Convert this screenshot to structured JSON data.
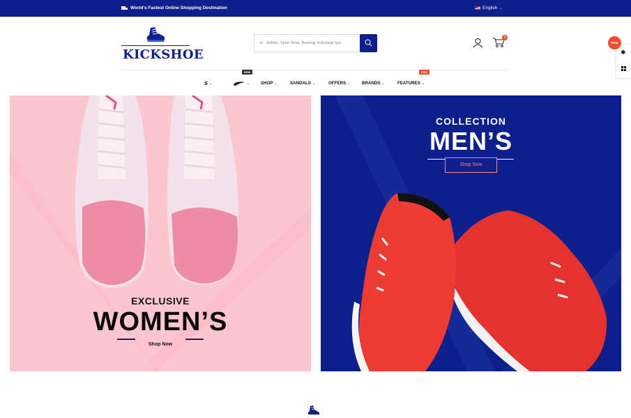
{
  "topbar": {
    "promo_text": "World's Fastest Online Shopping Destination",
    "language": "English",
    "icons": [
      "truck-icon",
      "flag-icon",
      "chevron-down-icon"
    ]
  },
  "header": {
    "logo_text": "KICKSHOE",
    "search_placeholder": "ex : Adidas, Sport Shoe, Bowling, Individual Spo",
    "cart_count": "0",
    "icons": [
      "search-icon",
      "user-icon",
      "cart-icon"
    ]
  },
  "sidebar_tools": {
    "new_badge": "NEW",
    "icons": [
      "gear-icon",
      "grid-icon"
    ]
  },
  "nav": {
    "items": [
      {
        "label": "S",
        "type": "brand-logo"
      },
      {
        "label": "",
        "type": "brand-logo",
        "badge": "NEW"
      },
      {
        "label": "SHOP"
      },
      {
        "label": "SANDALS"
      },
      {
        "label": "OFFERS"
      },
      {
        "label": "BRANDS",
        "badge": "PRO"
      },
      {
        "label": "FEATURES"
      }
    ],
    "badge_new": "NEW",
    "badge_pro": "PRO"
  },
  "banners": {
    "women": {
      "subtitle": "EXCLUSIVE",
      "title": "WOMEN’S",
      "button": "Shop Now",
      "bg_color": "#fcc6d0"
    },
    "men": {
      "subtitle": "COLLECTION",
      "title": "MEN’S",
      "button": "Shop Now",
      "bg_color": "#0c1f8a"
    }
  },
  "colors": {
    "brand": "#0c1f8a",
    "accent": "#ef4d2f",
    "pink": "#fcc6d0"
  }
}
